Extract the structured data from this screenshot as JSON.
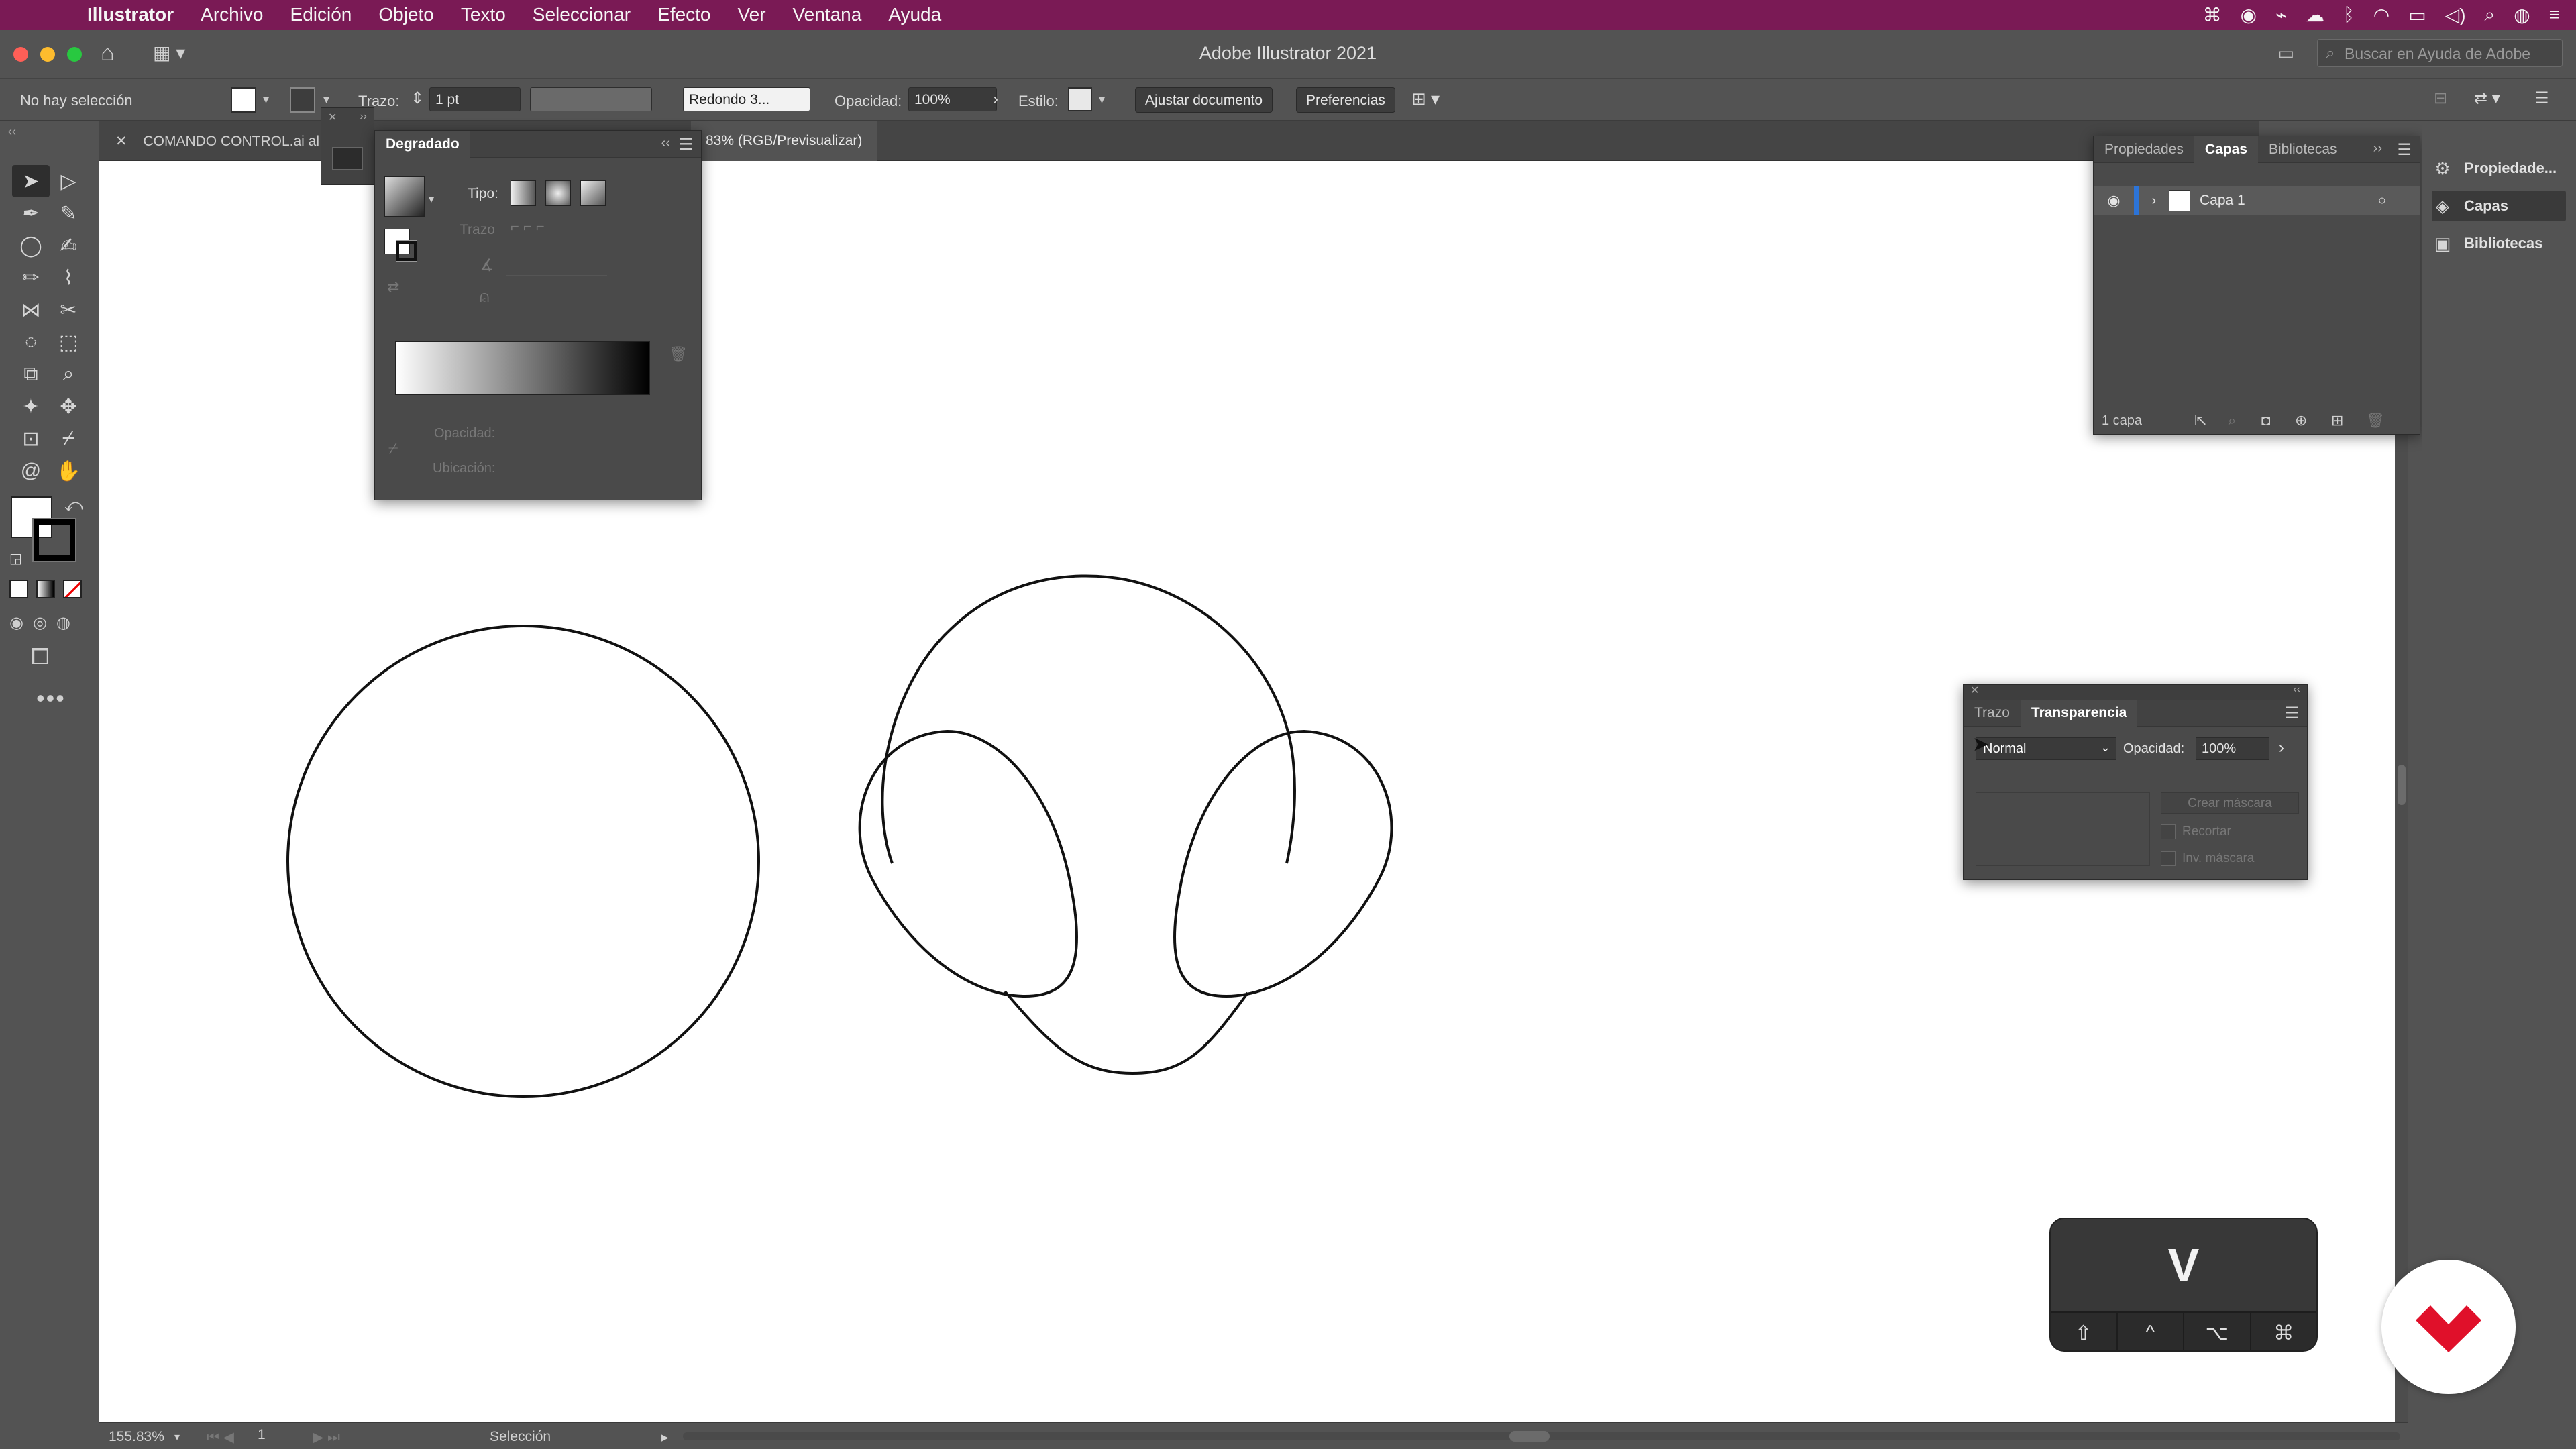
{
  "menubar": {
    "apple": "",
    "items": [
      "Illustrator",
      "Archivo",
      "Edición",
      "Objeto",
      "Texto",
      "Seleccionar",
      "Efecto",
      "Ver",
      "Ventana",
      "Ayuda"
    ]
  },
  "window": {
    "title": "Adobe Illustrator 2021",
    "help_placeholder": "Buscar en Ayuda de Adobe"
  },
  "controlbar": {
    "selection": "No hay selección",
    "stroke_label": "Trazo:",
    "stroke_weight": "1 pt",
    "brush": "Redondo 3...",
    "opacity_label": "Opacidad:",
    "opacity": "100%",
    "style_label": "Estilo:",
    "fit_button": "Ajustar documento",
    "prefs_button": "Preferencias"
  },
  "tabs": {
    "doc1": "COMANDO CONTROL.ai al 1",
    "doc2": "83% (RGB/Previsualizar)"
  },
  "gradient_panel": {
    "title": "Degradado",
    "type_label": "Tipo:",
    "stroke_label": "Trazo",
    "opacity_label": "Opacidad:",
    "location_label": "Ubicación:"
  },
  "layers_panel": {
    "tabs": [
      "Propiedades",
      "Capas",
      "Bibliotecas"
    ],
    "active_tab": 1,
    "layer_name": "Capa 1",
    "footer": "1 capa"
  },
  "right_dock": {
    "items": [
      "Propiedade...",
      "Capas",
      "Bibliotecas"
    ]
  },
  "transparency_panel": {
    "tabs": [
      "Trazo",
      "Transparencia"
    ],
    "blend_mode": "Normal",
    "opacity_label": "Opacidad:",
    "opacity": "100%",
    "make_mask": "Crear máscara",
    "clip": "Recortar",
    "invert_mask": "Inv. máscara"
  },
  "status": {
    "zoom": "155.83%",
    "artboard": "1",
    "tool": "Selección"
  },
  "key_overlay": {
    "key": "V",
    "mods": [
      "⇧",
      "^",
      "⌥",
      "⌘"
    ]
  },
  "colors": {
    "menubar": "#7a1a55",
    "accent": "#2c74d8",
    "brand": "#e0102a"
  }
}
